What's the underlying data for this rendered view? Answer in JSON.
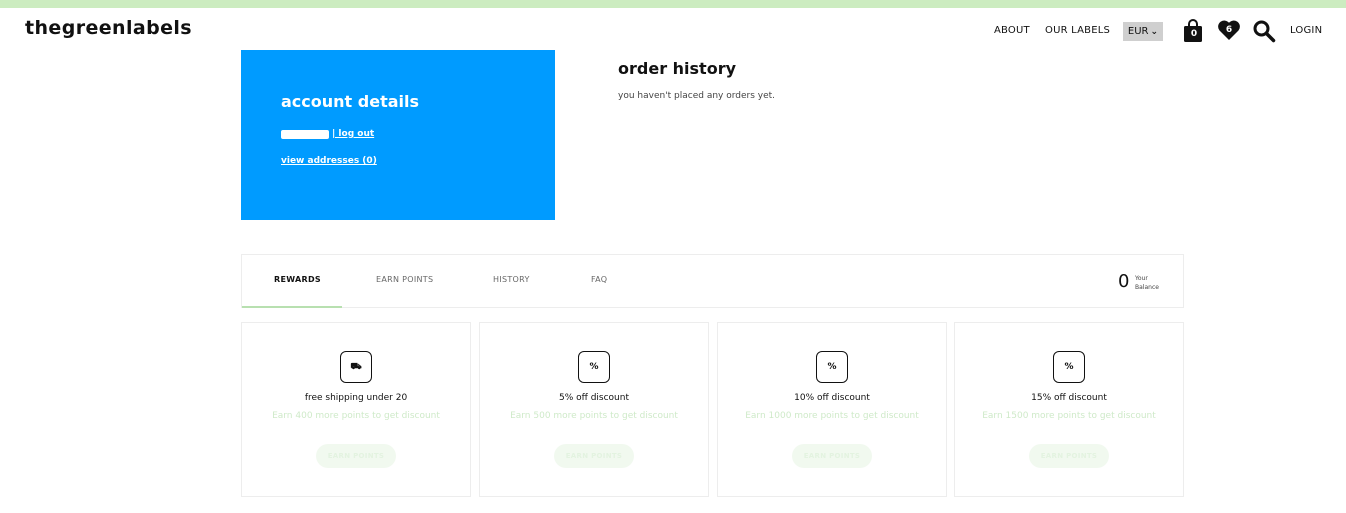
{
  "brand": {
    "logo_text": "thegreenlabels",
    "accent": "#009bff",
    "strip": "#ccecc0"
  },
  "nav": {
    "about": "ABOUT",
    "our_labels": "OUR LABELS",
    "currency": "EUR",
    "cart_count": "0",
    "wishlist_count": "6",
    "login": "LOGIN",
    "icons": [
      "bag-icon",
      "heart-icon",
      "search-icon"
    ]
  },
  "account": {
    "title": "account details",
    "logout": "| log out",
    "view_addresses": "view addresses (0)"
  },
  "orders": {
    "title": "order history",
    "empty_message": "you haven't placed any orders yet."
  },
  "rewards": {
    "tabs": [
      "REWARDS",
      "EARN POINTS",
      "HISTORY",
      "FAQ"
    ],
    "active_tab": "REWARDS",
    "balance_value": "0",
    "balance_label_1": "Your",
    "balance_label_2": "Balance"
  },
  "cards": [
    {
      "icon": "truck-icon",
      "icon_glyph": "⛟",
      "title": "free shipping under 20",
      "subtitle": "Earn 400 more points to get discount",
      "button": "EARN POINTS"
    },
    {
      "icon": "percent-icon",
      "icon_glyph": "%",
      "title": "5% off discount",
      "subtitle": "Earn 500 more points to get discount",
      "button": "EARN POINTS"
    },
    {
      "icon": "percent-icon",
      "icon_glyph": "%",
      "title": "10% off discount",
      "subtitle": "Earn 1000 more points to get discount",
      "button": "EARN POINTS"
    },
    {
      "icon": "percent-icon",
      "icon_glyph": "%",
      "title": "15% off discount",
      "subtitle": "Earn 1500 more points to get discount",
      "button": "EARN POINTS"
    }
  ]
}
